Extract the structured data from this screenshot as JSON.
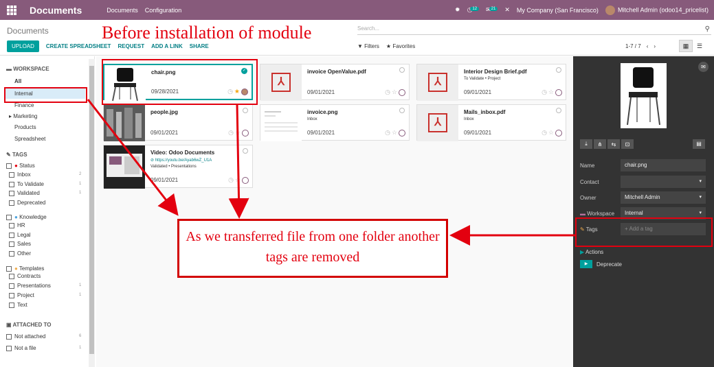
{
  "topbar": {
    "app_title": "Documents",
    "nav": [
      "Documents",
      "Configuration"
    ],
    "activity_count": "12",
    "messages_count": "21",
    "company": "My Company (San Francisco)",
    "user": "Mitchell Admin (odoo14_pricelist)"
  },
  "control": {
    "breadcrumb": "Documents",
    "search_placeholder": "Search...",
    "upload": "UPLOAD",
    "create_spreadsheet": "CREATE SPREADSHEET",
    "request": "REQUEST",
    "add_link": "ADD A LINK",
    "share": "SHARE",
    "filters": "Filters",
    "favorites": "Favorites",
    "pager": "1-7 / 7"
  },
  "sidebar": {
    "workspace_heading": "WORKSPACE",
    "workspaces": [
      "All",
      "Internal",
      "Finance",
      "Marketing",
      "Products",
      "Spreadsheet"
    ],
    "tags_heading": "TAGS",
    "status_label": "Status",
    "status_tags": [
      {
        "label": "Inbox",
        "count": "2"
      },
      {
        "label": "To Validate",
        "count": "1"
      },
      {
        "label": "Validated",
        "count": "1"
      },
      {
        "label": "Deprecated",
        "count": ""
      }
    ],
    "knowledge_label": "Knowledge",
    "knowledge_tags": [
      "HR",
      "Legal",
      "Sales",
      "Other"
    ],
    "templates_label": "Templates",
    "template_tags": [
      {
        "label": "Contracts",
        "count": ""
      },
      {
        "label": "Presentations",
        "count": "1"
      },
      {
        "label": "Project",
        "count": "1"
      },
      {
        "label": "Text",
        "count": ""
      }
    ],
    "attached_heading": "ATTACHED TO",
    "attached": [
      {
        "label": "Not attached",
        "count": "6"
      },
      {
        "label": "Not a file",
        "count": "1"
      }
    ]
  },
  "cards": [
    {
      "title": "chair.png",
      "date": "09/28/2021",
      "tags": ""
    },
    {
      "title": "invoice OpenValue.pdf",
      "date": "09/01/2021",
      "tags": ""
    },
    {
      "title": "Interior Design Brief.pdf",
      "date": "09/01/2021",
      "tags": "To Validate • Project"
    },
    {
      "title": "people.jpg",
      "date": "09/01/2021",
      "tags": ""
    },
    {
      "title": "invoice.png",
      "date": "09/01/2021",
      "tags": "Inbox"
    },
    {
      "title": "Mails_inbox.pdf",
      "date": "09/01/2021",
      "tags": "Inbox"
    },
    {
      "title": "Video: Odoo Documents",
      "date": "09/01/2021",
      "url": "https://youtu.be/Ayab6wZ_U1A",
      "tags": "Validated • Presentations"
    }
  ],
  "details": {
    "name_label": "Name",
    "name_value": "chair.png",
    "contact_label": "Contact",
    "contact_value": "",
    "owner_label": "Owner",
    "owner_value": "Mitchell Admin",
    "workspace_label": "Workspace",
    "workspace_value": "Internal",
    "tags_label": "Tags",
    "tags_placeholder": "+ Add a tag",
    "actions_label": "Actions",
    "deprecate_label": "Deprecate"
  },
  "annotations": {
    "title": "Before installation of module",
    "note": "As we transferred file from one folder another tags are removed"
  },
  "colors": {
    "primary": "#875a7b",
    "accent": "#00a09d",
    "annotation": "#e3000f"
  }
}
